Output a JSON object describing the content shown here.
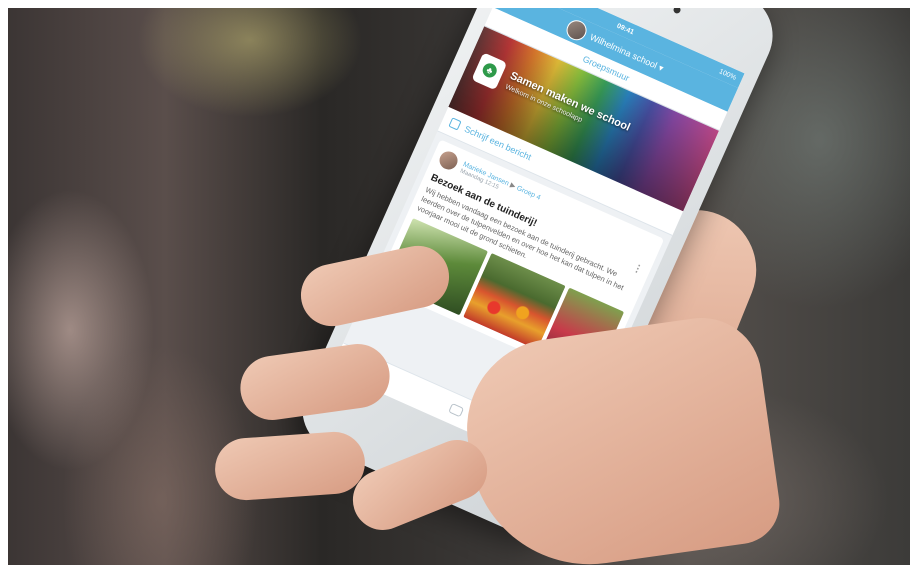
{
  "phone_app": {
    "status_bar": {
      "time": "09:41",
      "battery": "100%"
    },
    "header": {
      "school_name": "Wilhelmina school ▾"
    },
    "tab": {
      "label": "Groepsmuur"
    },
    "banner": {
      "title": "Samen maken we school",
      "subtitle": "Welkom in onze schoolapp"
    },
    "compose": {
      "label": "Schrijf een bericht"
    },
    "post": {
      "author": "Marieke Jansen",
      "separator": "▶",
      "group": "Groep 4",
      "date": "Maandag 12:15",
      "title": "Bezoek aan de tuinderij!",
      "body": "Wij hebben vandaag een bezoek aan de tuinderij gebracht. We leerden over de tulpenvelden en over hoe het kan dat tulpen in het voorjaar mooi uit de grond schieten."
    },
    "accent_color": "#5ab4e0"
  }
}
